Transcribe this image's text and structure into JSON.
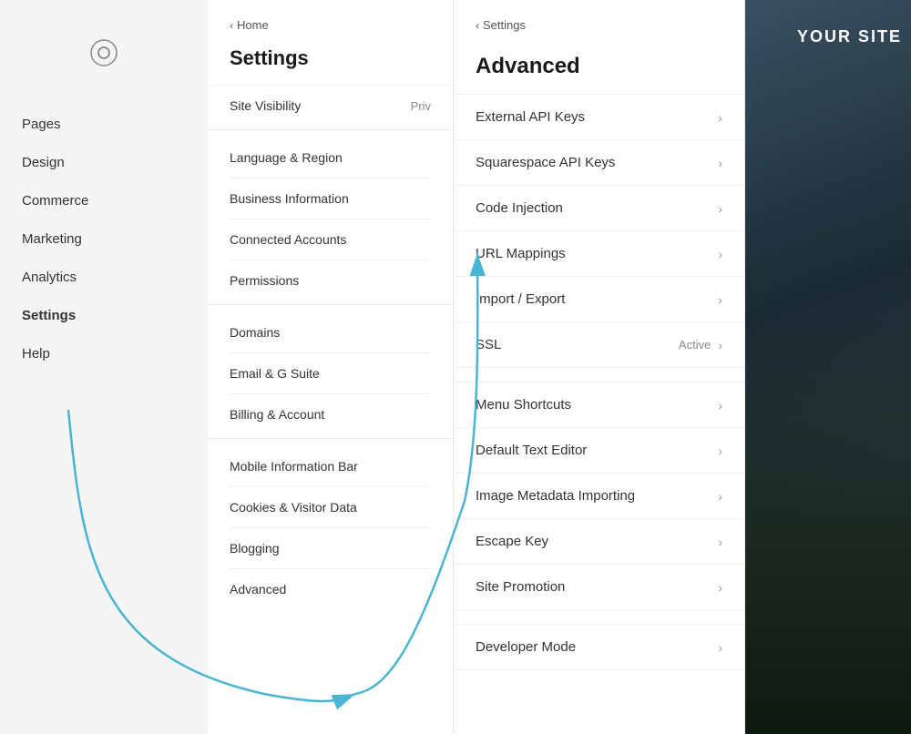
{
  "sidebar": {
    "logo_label": "Squarespace logo",
    "nav_items": [
      {
        "label": "Pages",
        "active": false
      },
      {
        "label": "Design",
        "active": false
      },
      {
        "label": "Commerce",
        "active": false
      },
      {
        "label": "Marketing",
        "active": false
      },
      {
        "label": "Analytics",
        "active": false
      },
      {
        "label": "Settings",
        "active": true
      },
      {
        "label": "Help",
        "active": false
      }
    ]
  },
  "settings_panel": {
    "back_label": "Home",
    "title": "Settings",
    "site_visibility_label": "Site Visibility",
    "site_visibility_value": "Priv",
    "group1": [
      {
        "label": "Language & Region"
      },
      {
        "label": "Business Information"
      },
      {
        "label": "Connected Accounts"
      },
      {
        "label": "Permissions"
      }
    ],
    "group2": [
      {
        "label": "Domains"
      },
      {
        "label": "Email & G Suite"
      },
      {
        "label": "Billing & Account"
      }
    ],
    "group3": [
      {
        "label": "Mobile Information Bar"
      },
      {
        "label": "Cookies & Visitor Data"
      },
      {
        "label": "Blogging"
      },
      {
        "label": "Advanced"
      }
    ]
  },
  "advanced_panel": {
    "back_label": "Settings",
    "title": "Advanced",
    "items_group1": [
      {
        "label": "External API Keys"
      },
      {
        "label": "Squarespace API Keys"
      },
      {
        "label": "Code Injection"
      },
      {
        "label": "URL Mappings"
      },
      {
        "label": "Import / Export"
      }
    ],
    "ssl_label": "SSL",
    "ssl_value": "Active",
    "items_group2": [
      {
        "label": "Menu Shortcuts"
      },
      {
        "label": "Default Text Editor"
      },
      {
        "label": "Image Metadata Importing"
      },
      {
        "label": "Escape Key"
      },
      {
        "label": "Site Promotion"
      }
    ],
    "items_group3": [
      {
        "label": "Developer Mode"
      }
    ]
  },
  "preview": {
    "overlay_text": "YOUR SITE"
  },
  "colors": {
    "accent_arrow": "#4ab4d4",
    "active_nav": "#000000"
  }
}
